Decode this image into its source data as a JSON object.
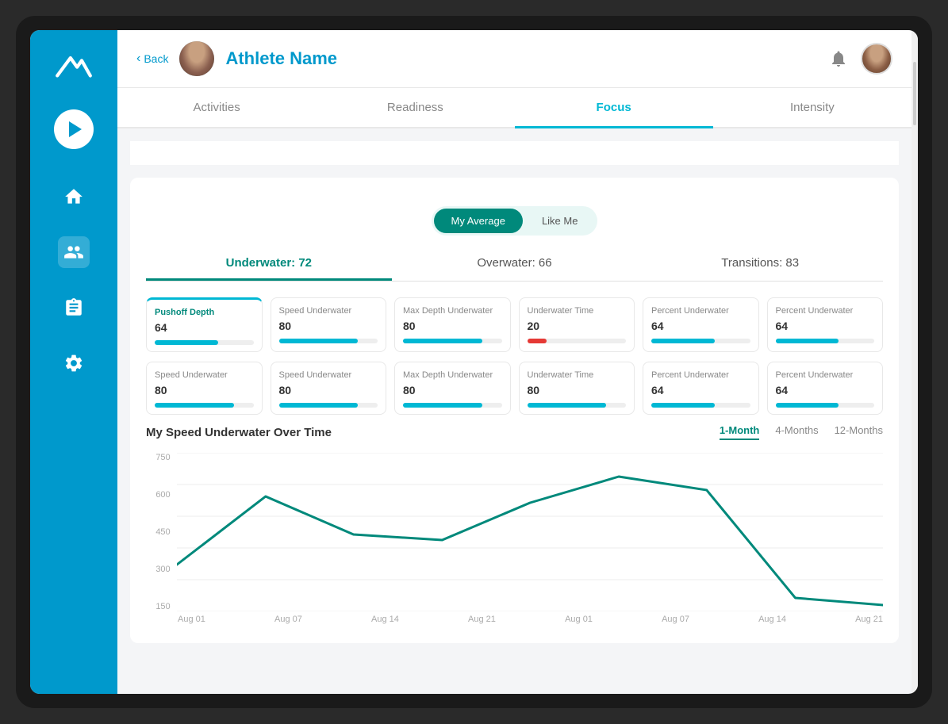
{
  "app": {
    "logo_alt": "App Logo"
  },
  "header": {
    "back_label": "Back",
    "athlete_name": "Athlete Name",
    "notification_icon": "bell-icon",
    "user_avatar_alt": "User Avatar"
  },
  "tabs": [
    {
      "id": "activities",
      "label": "Activities",
      "active": false
    },
    {
      "id": "readiness",
      "label": "Readiness",
      "active": false
    },
    {
      "id": "focus",
      "label": "Focus",
      "active": true
    },
    {
      "id": "intensity",
      "label": "Intensity",
      "active": false
    }
  ],
  "toggle": {
    "options": [
      {
        "id": "my-average",
        "label": "My Average",
        "active": true
      },
      {
        "id": "like-me",
        "label": "Like Me",
        "active": false
      }
    ]
  },
  "categories": [
    {
      "id": "underwater",
      "label": "Underwater: 72",
      "active": true
    },
    {
      "id": "overwater",
      "label": "Overwater: 66",
      "active": false
    },
    {
      "id": "transitions",
      "label": "Transitions: 83",
      "active": false
    }
  ],
  "metrics_row1": [
    {
      "name": "Pushoff Depth",
      "value": "64",
      "bar": 64,
      "bar_type": "teal",
      "highlight": true
    },
    {
      "name": "Speed Underwater",
      "value": "80",
      "bar": 80,
      "bar_type": "teal",
      "highlight": false
    },
    {
      "name": "Max Depth Underwater",
      "value": "80",
      "bar": 80,
      "bar_type": "teal",
      "highlight": false
    },
    {
      "name": "Underwater Time",
      "value": "20",
      "bar": 20,
      "bar_type": "red",
      "highlight": false
    },
    {
      "name": "Percent Underwater",
      "value": "64",
      "bar": 64,
      "bar_type": "teal",
      "highlight": false
    },
    {
      "name": "Percent Underwater",
      "value": "64",
      "bar": 64,
      "bar_type": "teal",
      "highlight": false
    }
  ],
  "metrics_row2": [
    {
      "name": "Speed Underwater",
      "value": "80",
      "bar": 80,
      "bar_type": "teal",
      "highlight": false
    },
    {
      "name": "Speed Underwater",
      "value": "80",
      "bar": 80,
      "bar_type": "teal",
      "highlight": false
    },
    {
      "name": "Max Depth Underwater",
      "value": "80",
      "bar": 80,
      "bar_type": "teal",
      "highlight": false
    },
    {
      "name": "Underwater Time",
      "value": "80",
      "bar": 80,
      "bar_type": "teal",
      "highlight": false
    },
    {
      "name": "Percent Underwater",
      "value": "64",
      "bar": 64,
      "bar_type": "teal",
      "highlight": false
    },
    {
      "name": "Percent Underwater",
      "value": "64",
      "bar": 64,
      "bar_type": "teal",
      "highlight": false
    }
  ],
  "chart": {
    "title": "My Speed Underwater Over Time",
    "time_filters": [
      {
        "id": "1-month",
        "label": "1-Month",
        "active": true
      },
      {
        "id": "4-months",
        "label": "4-Months",
        "active": false
      },
      {
        "id": "12-months",
        "label": "12-Months",
        "active": false
      }
    ],
    "y_labels": [
      "750",
      "600",
      "450",
      "300",
      "150"
    ],
    "x_labels": [
      "Aug 01",
      "Aug 07",
      "Aug 14",
      "Aug 21",
      "Aug 01",
      "Aug 07",
      "Aug 14",
      "Aug 21"
    ],
    "color": "#00897b"
  },
  "sidebar": {
    "nav_items": [
      {
        "id": "home",
        "icon": "home-icon"
      },
      {
        "id": "team",
        "icon": "team-icon",
        "active": true
      },
      {
        "id": "clipboard",
        "icon": "clipboard-icon"
      },
      {
        "id": "settings",
        "icon": "settings-icon"
      }
    ]
  }
}
